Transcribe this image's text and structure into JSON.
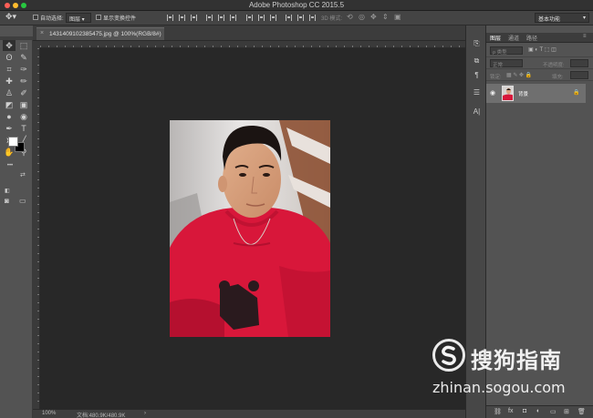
{
  "window": {
    "title": "Adobe Photoshop CC 2015.5",
    "traffic_colors": [
      "#ff5f57",
      "#febc2e",
      "#28c840"
    ]
  },
  "options_bar": {
    "auto_select_label": "自动选择:",
    "auto_select_value": "图层",
    "show_transform_label": "显示变换控件",
    "mode_3d_label": "3D 模式:",
    "workspace": "基本功能"
  },
  "document": {
    "tab_label": "1431409102385475.jpg @ 100%(RGB/8#)",
    "close_glyph": "×"
  },
  "tools": [
    {
      "icon": "move-icon",
      "glyph": "✥"
    },
    {
      "icon": "marquee-icon",
      "glyph": "⬚"
    },
    {
      "icon": "lasso-icon",
      "glyph": "ʘ"
    },
    {
      "icon": "quick-select-icon",
      "glyph": "✎"
    },
    {
      "icon": "crop-icon",
      "glyph": "⌗"
    },
    {
      "icon": "eyedropper-icon",
      "glyph": "✑"
    },
    {
      "icon": "healing-icon",
      "glyph": "✚"
    },
    {
      "icon": "brush-icon",
      "glyph": "✏"
    },
    {
      "icon": "stamp-icon",
      "glyph": "♙"
    },
    {
      "icon": "history-brush-icon",
      "glyph": "✐"
    },
    {
      "icon": "eraser-icon",
      "glyph": "◩"
    },
    {
      "icon": "gradient-icon",
      "glyph": "▣"
    },
    {
      "icon": "blur-icon",
      "glyph": "●"
    },
    {
      "icon": "dodge-icon",
      "glyph": "◉"
    },
    {
      "icon": "pen-icon",
      "glyph": "✒"
    },
    {
      "icon": "type-icon",
      "glyph": "T"
    },
    {
      "icon": "path-select-icon",
      "glyph": "➤"
    },
    {
      "icon": "line-icon",
      "glyph": "╱"
    },
    {
      "icon": "hand-icon",
      "glyph": "✋"
    },
    {
      "icon": "zoom-icon",
      "glyph": "⚲"
    },
    {
      "icon": "more-tools-icon",
      "glyph": "•••"
    }
  ],
  "colors": {
    "foreground": "#ffffff",
    "background": "#000000",
    "canvas": "#282828",
    "shirt": "#d8173a"
  },
  "status": {
    "zoom": "100%",
    "doc_info": "文档:480.9K/480.9K"
  },
  "layers_panel": {
    "tabs": [
      "图层",
      "通道",
      "路径"
    ],
    "filter_placeholder": "ρ 类型",
    "blend_mode": "正常",
    "opacity_label": "不透明度:",
    "lock_label": "锁定:",
    "fill_label": "填充:",
    "layer_name": "背景"
  },
  "watermark": {
    "brand_cn": "搜狗指南",
    "url": "zhinan.sogou.com"
  }
}
